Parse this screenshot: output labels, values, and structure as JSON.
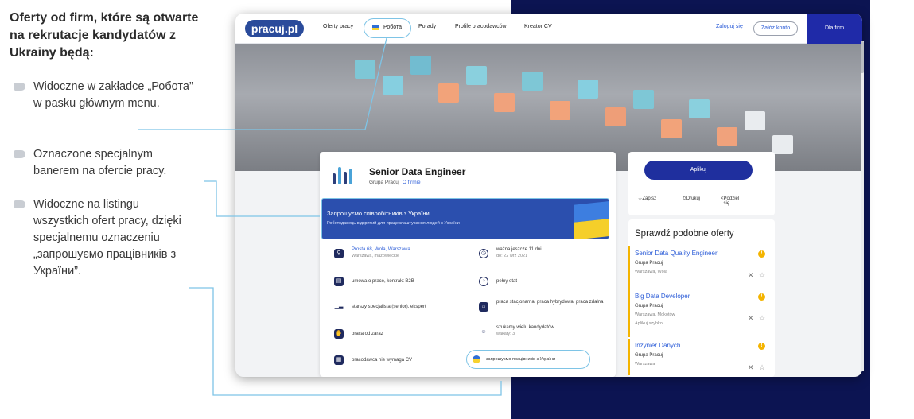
{
  "annotation": {
    "title": "Oferty od firm, które są otwarte na rekrutacje kandydatów z Ukrainy będą:",
    "bullets": [
      "Widoczne w zakładce „Робота” w pasku głównym menu.",
      "Oznaczone specjalnym banerem na ofercie pracy.",
      "Widoczne na listingu wszystkich ofert pracy, dzięki specjalnemu oznaczeniu „запрошуємо працівників з України”."
    ]
  },
  "nav": {
    "logo": "pracuj.pl",
    "items": [
      "Oferty pracy",
      "Робота",
      "Porady",
      "Profile pracodawców",
      "Kreator CV"
    ],
    "login": "Zaloguj się",
    "register": "Załóż konto",
    "for_companies": "Dla firm"
  },
  "job": {
    "title": "Senior Data Engineer",
    "company": "Grupa Pracuj",
    "about_link": "O firmie",
    "banner_title": "Запрошуємо співробітників з України",
    "banner_sub": "Роботодавець відкритий для працевлаштування людей з України",
    "details": [
      {
        "icon": "location-pin-icon",
        "text": "Prosta 68, Wola, Warszawa",
        "sub": "Warszawa, mazowieckie"
      },
      {
        "icon": "clock-icon",
        "text": "ważna jeszcze 11 dni",
        "sub": "do: 22 wrz 2021"
      },
      {
        "icon": "document-icon",
        "text": "umowa o pracę, kontrakt B2B",
        "sub": ""
      },
      {
        "icon": "pie-icon",
        "text": "pełny etat",
        "sub": ""
      },
      {
        "icon": "signal-bars-icon",
        "text": "starszy specjalista (senior), ekspert",
        "sub": ""
      },
      {
        "icon": "house-icon",
        "text": "praca stacjonarna, praca hybrydowa, praca zdalna",
        "sub": ""
      },
      {
        "icon": "hand-icon",
        "text": "praca od zaraz",
        "sub": ""
      },
      {
        "icon": "person-icon",
        "text": "szukamy wielu kandydatów",
        "sub": "wakaty: 3"
      },
      {
        "icon": "cv-icon",
        "text": "pracodawca nie wymaga CV",
        "sub": ""
      },
      {
        "icon": "ukraine-flag-icon",
        "text": "запрошуємо працівників з України",
        "sub": ""
      }
    ]
  },
  "apply": {
    "button": "Aplikuj",
    "save": "Zapisz",
    "print": "Drukuj",
    "share": "Podziel się"
  },
  "similar": {
    "title": "Sprawdź podobne oferty",
    "offers": [
      {
        "title": "Senior Data Quality Engineer",
        "company": "Grupa Pracuj",
        "location": "Warszawa, Wola",
        "quick": ""
      },
      {
        "title": "Big Data Developer",
        "company": "Grupa Pracuj",
        "location": "Warszawa, Mokotów",
        "quick": "Aplikuj szybko"
      },
      {
        "title": "Inżynier Danych",
        "company": "Grupa Pracuj",
        "location": "Warszawa",
        "quick": ""
      }
    ]
  },
  "colors": {
    "navy": "#0c1452",
    "brand_blue": "#2a4b9b",
    "apply_blue": "#1f2f9e",
    "highlight": "#7ec4e6",
    "ukraine_blue": "#2f6fd6",
    "ukraine_yellow": "#f7d22f"
  }
}
